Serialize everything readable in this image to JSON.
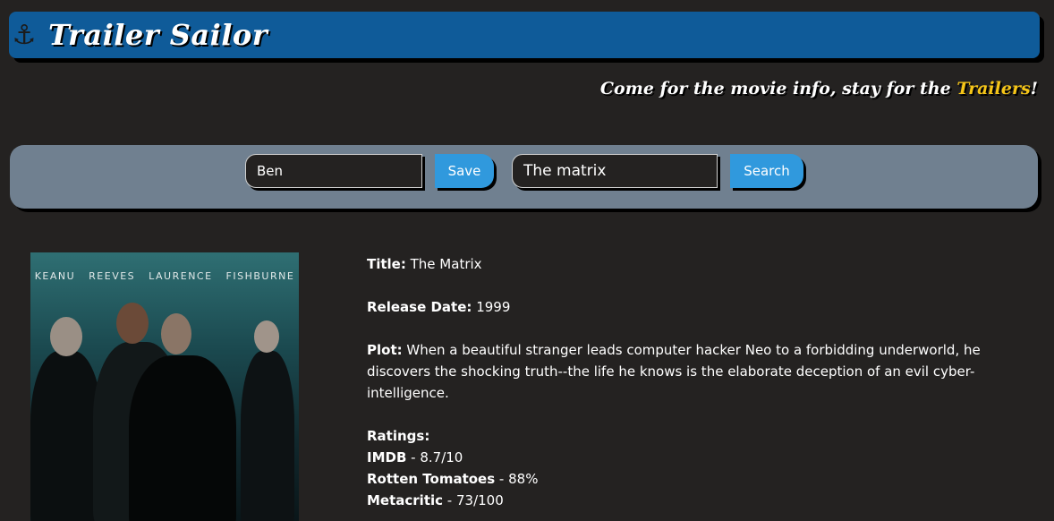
{
  "header": {
    "logo_icon": "anchor-icon",
    "logo_glyph": "⚓",
    "brand": "Trailer Sailor",
    "bg_color": "#0f5b99"
  },
  "tagline": {
    "prefix": "Come for the movie info, stay for the ",
    "accent": "Trailers",
    "suffix": "!",
    "accent_color": "#f5c518"
  },
  "search": {
    "name_value": "Ben",
    "save_label": "Save",
    "movie_value": "The matrix",
    "search_label": "Search",
    "button_color": "#3099dd",
    "bar_color": "#708090"
  },
  "poster": {
    "cast_text": "KEANU REEVES   LAURENCE FISHBURNE",
    "alt": "The Matrix poster"
  },
  "movie": {
    "title_label": "Title:",
    "title": "The Matrix",
    "release_label": "Release Date:",
    "release": "1999",
    "plot_label": "Plot:",
    "plot": "When a beautiful stranger leads computer hacker Neo to a forbidding underworld, he discovers the shocking truth--the life he knows is the elaborate deception of an evil cyber-intelligence.",
    "ratings_label": "Ratings:",
    "ratings": [
      {
        "source": "IMDB",
        "value": "8.7/10"
      },
      {
        "source": "Rotten Tomatoes",
        "value": "88%"
      },
      {
        "source": "Metacritic",
        "value": "73/100"
      }
    ]
  }
}
